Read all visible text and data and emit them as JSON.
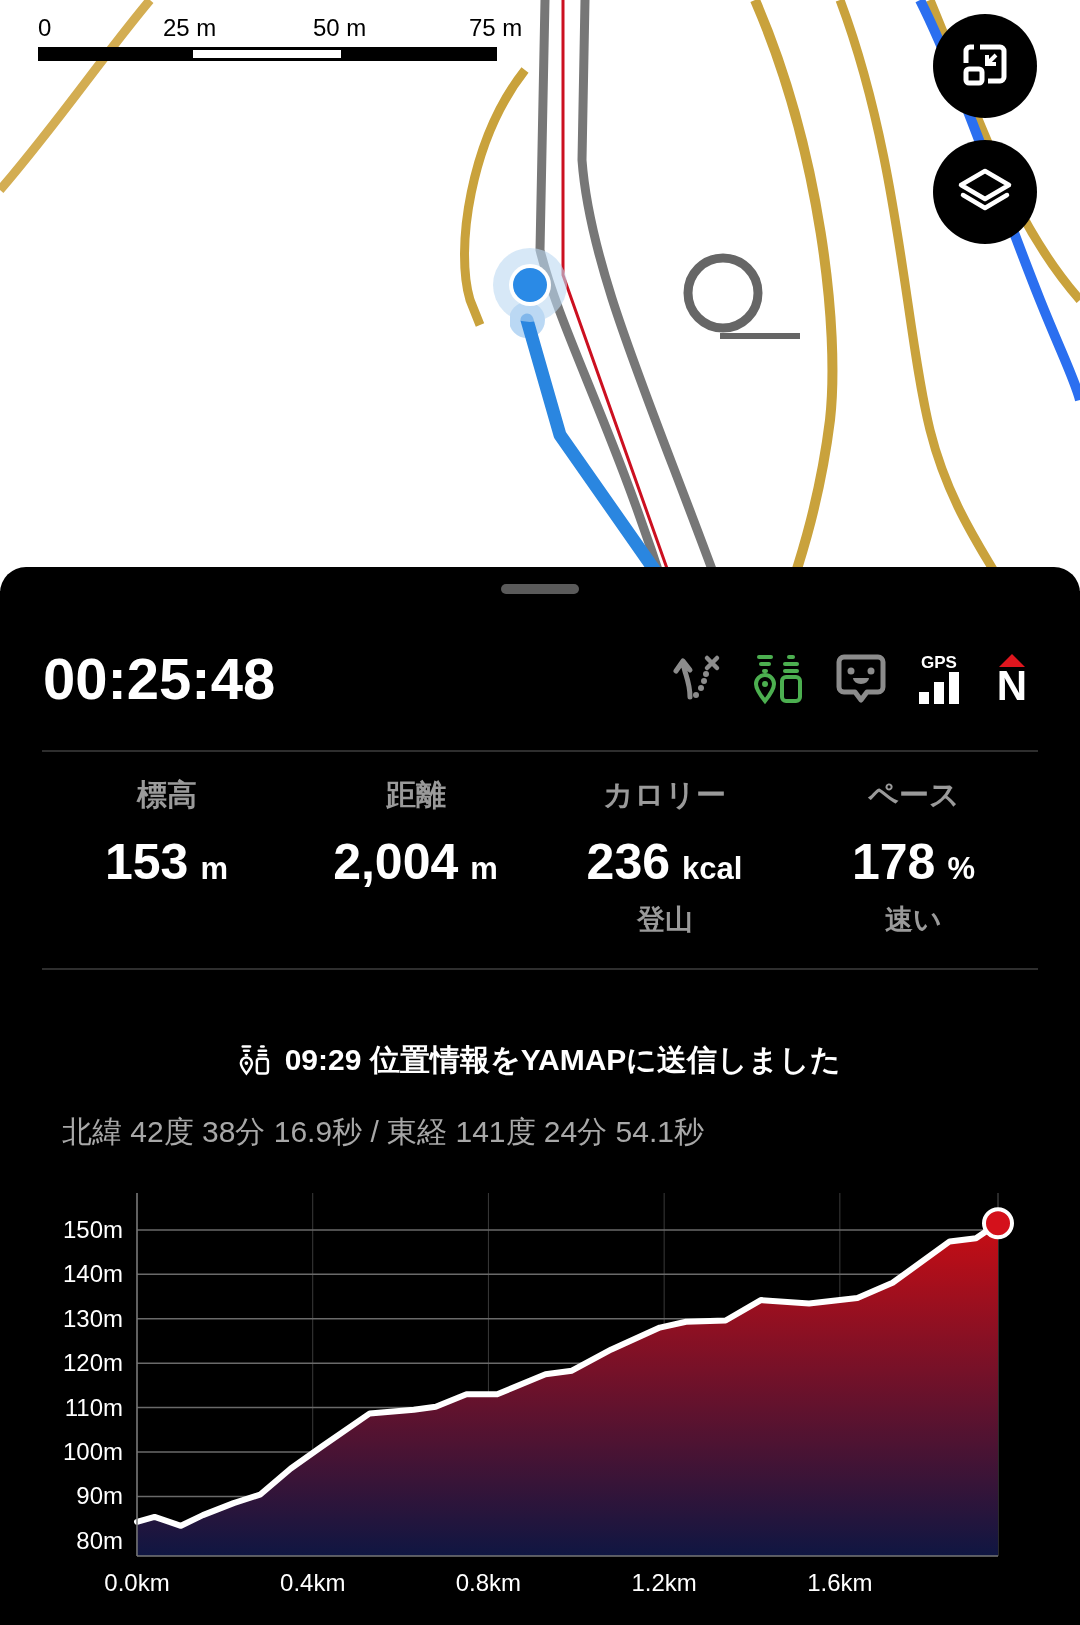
{
  "map": {
    "scale_bar": {
      "labels": [
        "0",
        "25 m",
        "50 m",
        "75 m"
      ]
    },
    "buttons": [
      {
        "kind": "shrink"
      },
      {
        "kind": "layers"
      }
    ]
  },
  "sheet": {
    "timer": "00:25:48",
    "status_toggles": [
      {
        "kind": "route",
        "on": false
      },
      {
        "kind": "location_send",
        "on": true
      },
      {
        "kind": "chat",
        "on": false
      }
    ],
    "gps": {
      "label": "GPS"
    },
    "compass": {
      "label": "N"
    },
    "stats": [
      {
        "label": "標高",
        "value": "153",
        "unit": "m"
      },
      {
        "label": "距離",
        "value": "2,004",
        "unit": "m"
      },
      {
        "label": "カロリー",
        "value": "236",
        "unit": "kcal",
        "note": "登山"
      },
      {
        "label": "ペース",
        "value": "178",
        "unit": "%",
        "note": "速い"
      }
    ],
    "message": "09:29 位置情報をYAMAPに送信しました",
    "coordinates": "北緯 42度 38分 16.9秒 / 東経 141度 24分 54.1秒",
    "chart_data": {
      "type": "area",
      "grid": true,
      "x": [
        0,
        0.04,
        0.1,
        0.15,
        0.22,
        0.28,
        0.35,
        0.42,
        0.53,
        0.63,
        0.68,
        0.75,
        0.82,
        0.93,
        0.99,
        1.08,
        1.19,
        1.25,
        1.34,
        1.42,
        1.53,
        1.64,
        1.72,
        1.85,
        1.91,
        1.96
      ],
      "series": [
        {
          "color": "#ffffff",
          "values": [
            84.3,
            85.4,
            83.4,
            85.8,
            88.5,
            90.4,
            96.3,
            101.2,
            108.7,
            109.5,
            110.2,
            113,
            113,
            117.5,
            118.3,
            123.1,
            128,
            129.3,
            129.6,
            134.2,
            133.4,
            134.7,
            138.1,
            147.4,
            148.1,
            151.5
          ]
        }
      ],
      "xlim": [
        0,
        1.96
      ],
      "ylim": [
        76.6,
        158.3
      ],
      "xticks": [
        {
          "value": 0,
          "label": "0.0km"
        },
        {
          "value": 0.4,
          "label": "0.4km"
        },
        {
          "value": 0.8,
          "label": "0.8km"
        },
        {
          "value": 1.2,
          "label": "1.2km"
        },
        {
          "value": 1.6,
          "label": "1.6km"
        }
      ],
      "yticks": [
        {
          "value": 80,
          "label": "80m"
        },
        {
          "value": 90,
          "label": "90m"
        },
        {
          "value": 100,
          "label": "100m"
        },
        {
          "value": 110,
          "label": "110m"
        },
        {
          "value": 120,
          "label": "120m"
        },
        {
          "value": 130,
          "label": "130m"
        },
        {
          "value": 140,
          "label": "140m"
        },
        {
          "value": 150,
          "label": "150m"
        }
      ]
    }
  }
}
